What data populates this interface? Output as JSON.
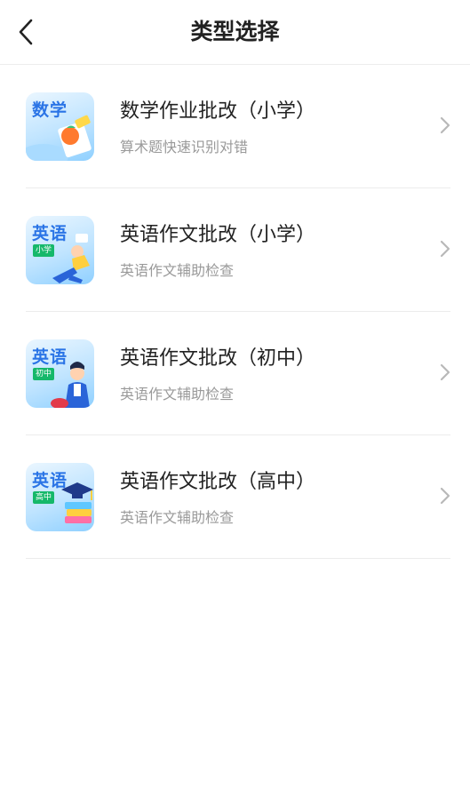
{
  "header": {
    "title": "类型选择",
    "back_icon": "chevron-left-icon"
  },
  "items": [
    {
      "title": "数学作业批改（小学）",
      "subtitle": "算术题快速识别对错",
      "thumb_word": "数学",
      "thumb_tag": ""
    },
    {
      "title": "英语作文批改（小学）",
      "subtitle": "英语作文辅助检查",
      "thumb_word": "英语",
      "thumb_tag": "小学"
    },
    {
      "title": "英语作文批改（初中）",
      "subtitle": "英语作文辅助检查",
      "thumb_word": "英语",
      "thumb_tag": "初中"
    },
    {
      "title": "英语作文批改（高中）",
      "subtitle": "英语作文辅助检查",
      "thumb_word": "英语",
      "thumb_tag": "高中"
    }
  ],
  "colors": {
    "accent": "#2a74e6",
    "tag": "#15b86a",
    "subtitle": "#9a9a9a",
    "divider": "#ececec"
  }
}
